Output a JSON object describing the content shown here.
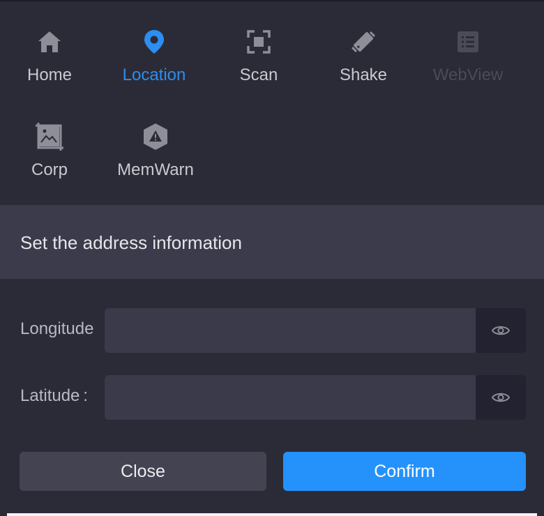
{
  "toolbar": {
    "items": [
      {
        "label": "Home",
        "icon": "home-icon",
        "state": "normal"
      },
      {
        "label": "Location",
        "icon": "location-pin-icon",
        "state": "active"
      },
      {
        "label": "Scan",
        "icon": "scan-icon",
        "state": "normal"
      },
      {
        "label": "Shake",
        "icon": "shake-icon",
        "state": "normal"
      },
      {
        "label": "WebView",
        "icon": "webview-icon",
        "state": "disabled"
      },
      {
        "label": "Corp",
        "icon": "crop-icon",
        "state": "normal"
      },
      {
        "label": "MemWarn",
        "icon": "warning-icon",
        "state": "normal"
      }
    ]
  },
  "dialog": {
    "title": "Set the address information",
    "fields": [
      {
        "label": "Longitude",
        "value": "",
        "placeholder": ""
      },
      {
        "label": "Latitude :",
        "value": "",
        "placeholder": ""
      }
    ],
    "close_label": "Close",
    "confirm_label": "Confirm"
  },
  "colors": {
    "background": "#2b2b37",
    "accent": "#2592fb",
    "icon_gray": "#8e8e98",
    "disabled": "#4b4b58"
  }
}
